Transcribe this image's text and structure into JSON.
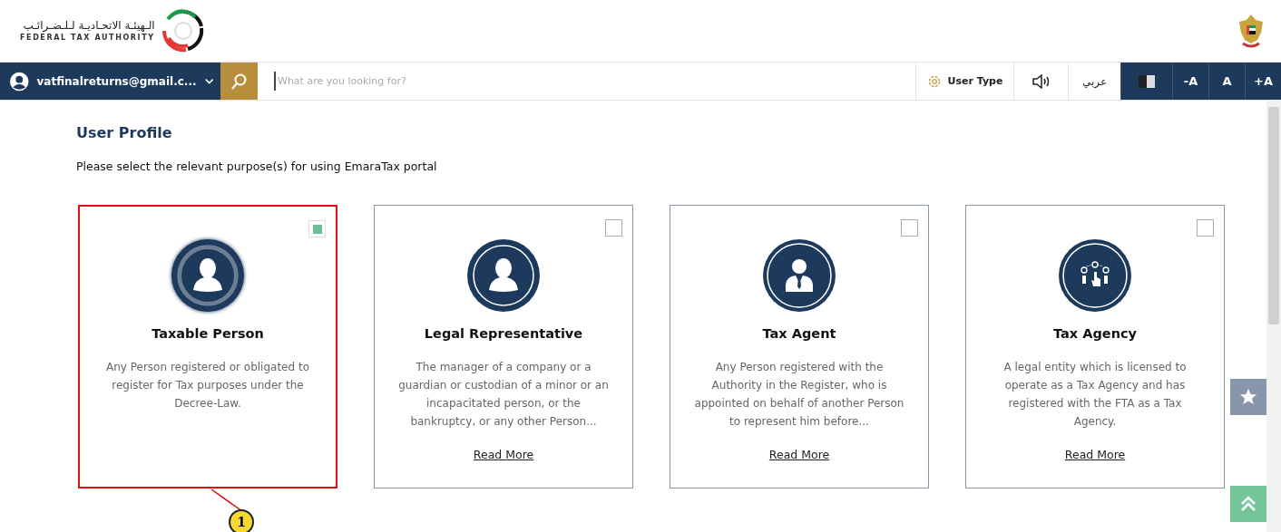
{
  "logo": {
    "arabic": "الـهيئـة الاتحـاديـة لـلـضـرائـب",
    "english": "FEDERAL TAX AUTHORITY"
  },
  "navbar": {
    "user": "vatfinalreturns@gmail.c...",
    "search_placeholder": "What are you looking for?",
    "user_type": "User Type",
    "language": "عربي",
    "font_buttons": [
      "-A",
      "A",
      "+A"
    ]
  },
  "page": {
    "title": "User Profile",
    "subtitle": "Please select the relevant purpose(s) for using EmaraTax portal"
  },
  "cards": [
    {
      "kind": "person",
      "title": "Taxable Person",
      "description": "Any Person registered or obligated to register for Tax purposes under the Decree-Law.",
      "checked": true,
      "highlighted": true
    },
    {
      "kind": "person",
      "title": "Legal Representative",
      "description": "The manager of a company or a guardian or custodian of a minor or an incapacitated person, or the bankruptcy, or any other Person...",
      "checked": false,
      "highlighted": false,
      "link": "Read More"
    },
    {
      "kind": "agent",
      "title": "Tax Agent",
      "description": "Any Person registered with the Authority in the Register, who is appointed on behalf of another Person to represent him before...",
      "checked": false,
      "highlighted": false,
      "link": "Read More"
    },
    {
      "kind": "agency",
      "title": "Tax Agency",
      "description": "A legal entity which is licensed to operate as a Tax Agency and has registered with the FTA as a Tax Agency.",
      "checked": false,
      "highlighted": false,
      "link": "Read More"
    }
  ],
  "callout": "1"
}
